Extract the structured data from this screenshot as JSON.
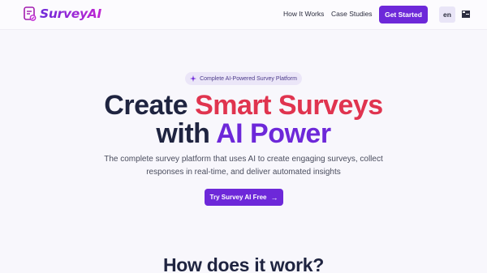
{
  "header": {
    "brand": "SurveyAI",
    "nav": [
      "How It Works",
      "Case Studies"
    ],
    "cta_label": "Get Started",
    "language": "en"
  },
  "hero": {
    "badge": "Complete AI-Powered Survey Platform",
    "title_part1": "Create ",
    "title_highlight1": "Smart Surveys",
    "title_part2": "with ",
    "title_highlight2": "AI Power",
    "subtitle_line1": "The complete survey platform that uses AI to create engaging surveys, collect",
    "subtitle_line2": "responses in real-time, and deliver automated insights",
    "cta_label": "Try Survey AI Free",
    "cta_icon": "→"
  },
  "how_section": {
    "title": "How does it work?"
  },
  "colors": {
    "accent": "#6d28d9",
    "highlight_red": "#e0344f",
    "background": "#f8f7fc"
  },
  "icons": [
    "survey-logo-icon",
    "sparkle-icon",
    "arrow-right-icon",
    "flag-icon"
  ]
}
